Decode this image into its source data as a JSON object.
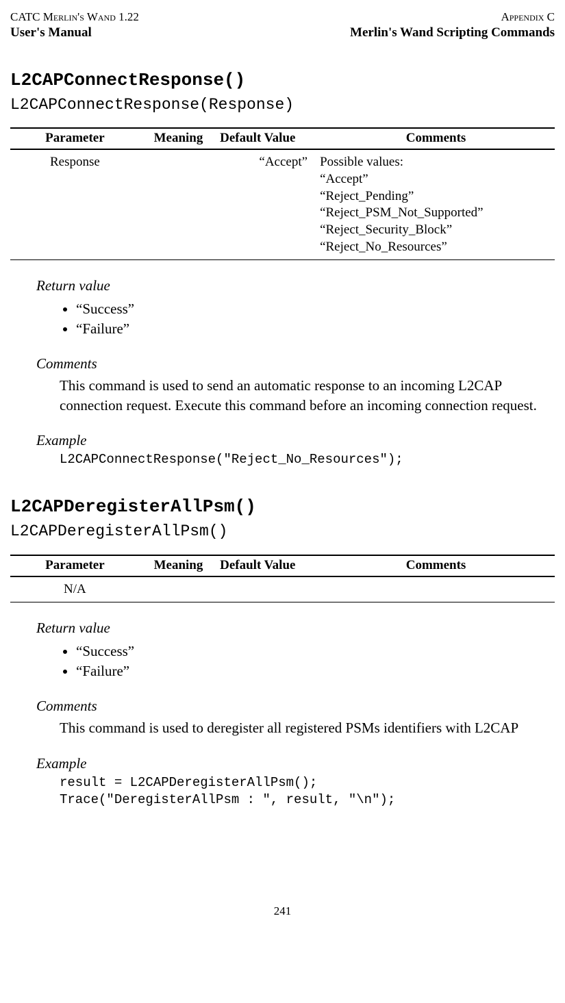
{
  "header": {
    "top_left": "CATC Merlin's Wand 1.22",
    "top_right": "Appendix C",
    "bottom_left": "User's Manual",
    "bottom_right": "Merlin's Wand Scripting Commands"
  },
  "table_headers": {
    "parameter": "Parameter",
    "meaning": "Meaning",
    "default": "Default Value",
    "comments": "Comments"
  },
  "labels": {
    "return_value": "Return value",
    "comments": "Comments",
    "example": "Example"
  },
  "cmd1": {
    "title": "L2CAPConnectResponse()",
    "signature": "L2CAPConnectResponse(Response)",
    "row": {
      "parameter": "Response",
      "meaning": "",
      "default": "“Accept”",
      "comments": "Possible values:\n“Accept”\n“Reject_Pending”\n“Reject_PSM_Not_Supported”\n“Reject_Security_Block”\n“Reject_No_Resources”"
    },
    "return_values": [
      "“Success”",
      "“Failure”"
    ],
    "comments_body": "This command is used to send an automatic response to an incoming L2CAP connection request. Execute this command before an incoming connection request.",
    "example_code": "L2CAPConnectResponse(\"Reject_No_Resources\");"
  },
  "cmd2": {
    "title": "L2CAPDeregisterAllPsm()",
    "signature": "L2CAPDeregisterAllPsm()",
    "row": {
      "parameter": "N/A",
      "meaning": "",
      "default": "",
      "comments": ""
    },
    "return_values": [
      "“Success”",
      "“Failure”"
    ],
    "comments_body": "This command is used to deregister all registered PSMs identifiers with L2CAP",
    "example_code": "result = L2CAPDeregisterAllPsm();\nTrace(\"DeregisterAllPsm : \", result, \"\\n\");"
  },
  "page_number": "241"
}
